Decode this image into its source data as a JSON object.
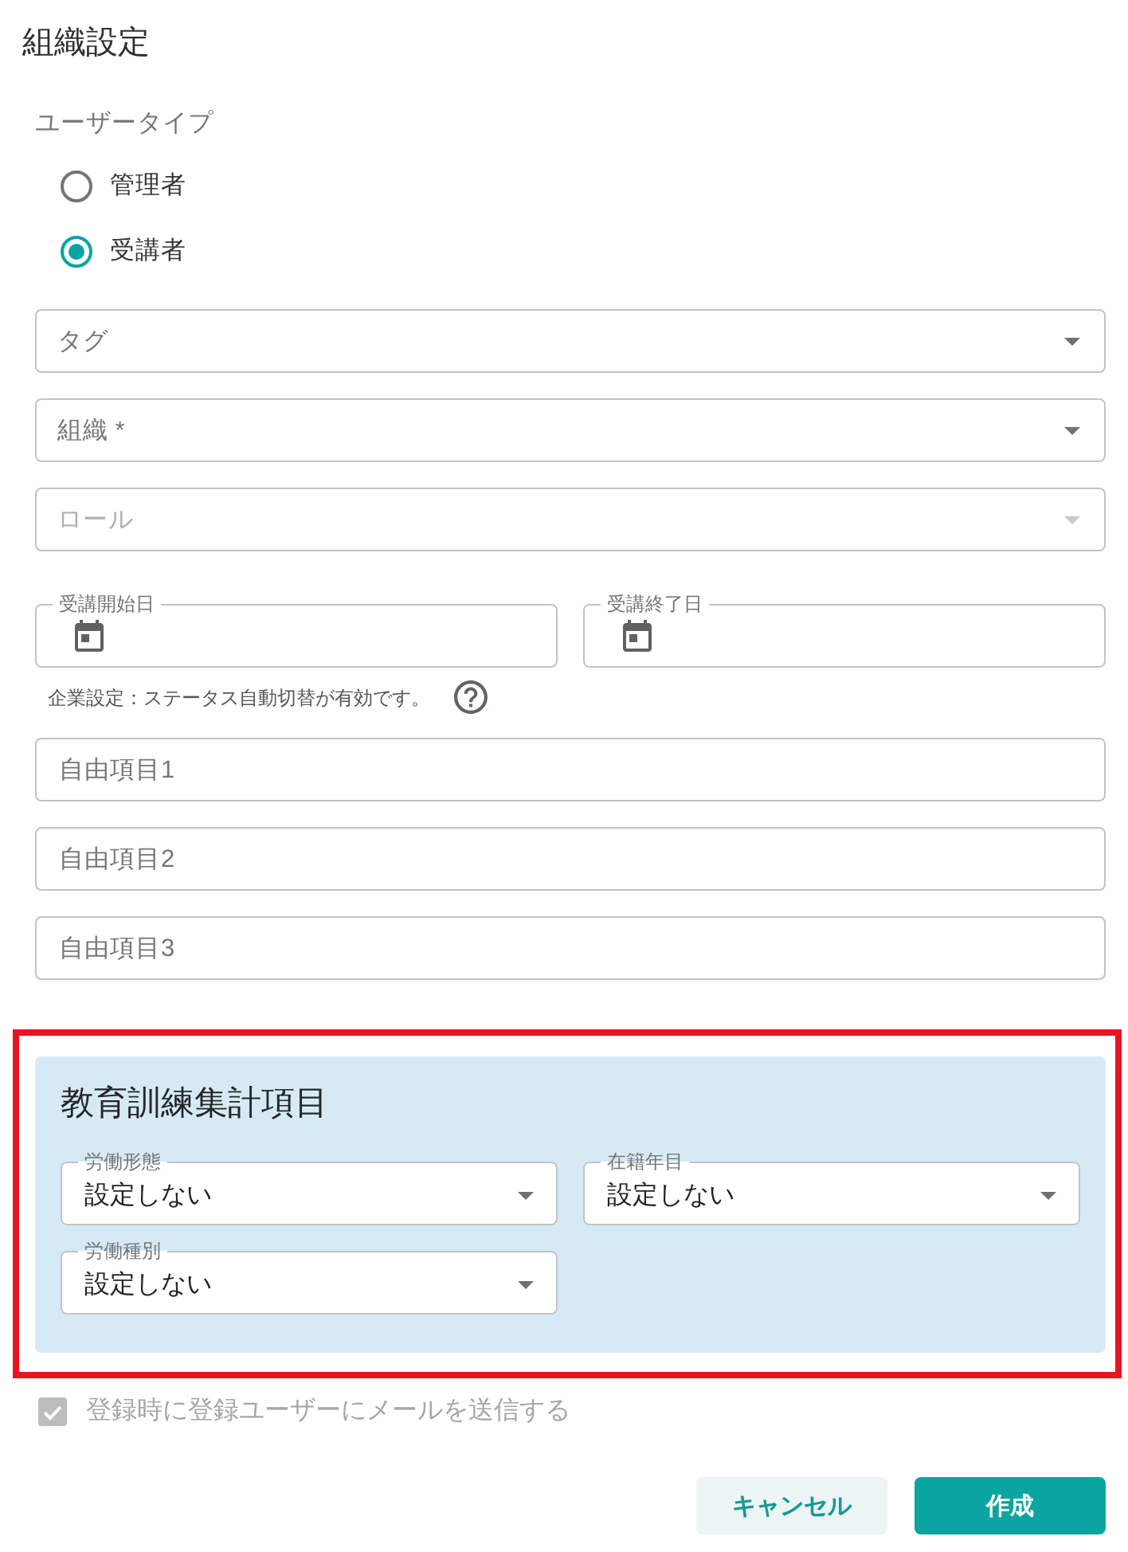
{
  "title": "組織設定",
  "user_type": {
    "label": "ユーザータイプ",
    "options": [
      {
        "label": "管理者",
        "selected": false
      },
      {
        "label": "受講者",
        "selected": true
      }
    ]
  },
  "selects": [
    {
      "label": "タグ",
      "disabled": false
    },
    {
      "label": "組織 *",
      "disabled": false
    },
    {
      "label": "ロール",
      "disabled": true
    }
  ],
  "date_fields": [
    {
      "label": "受講開始日"
    },
    {
      "label": "受講終了日"
    }
  ],
  "date_note": "企業設定：ステータス自動切替が有効です。",
  "free_fields": [
    {
      "label": "自由項目1"
    },
    {
      "label": "自由項目2"
    },
    {
      "label": "自由項目3"
    }
  ],
  "training_section": {
    "title": "教育訓練集計項目",
    "highlighted": true,
    "selects": [
      {
        "label": "労働形態",
        "value": "設定しない"
      },
      {
        "label": "在籍年目",
        "value": "設定しない"
      },
      {
        "label": "労働種別",
        "value": "設定しない"
      }
    ]
  },
  "send_mail": {
    "label": "登録時に登録ユーザーにメールを送信する",
    "checked": true,
    "disabled": true
  },
  "buttons": [
    {
      "label": "キャンセル",
      "kind": "secondary"
    },
    {
      "label": "作成",
      "kind": "primary"
    }
  ]
}
